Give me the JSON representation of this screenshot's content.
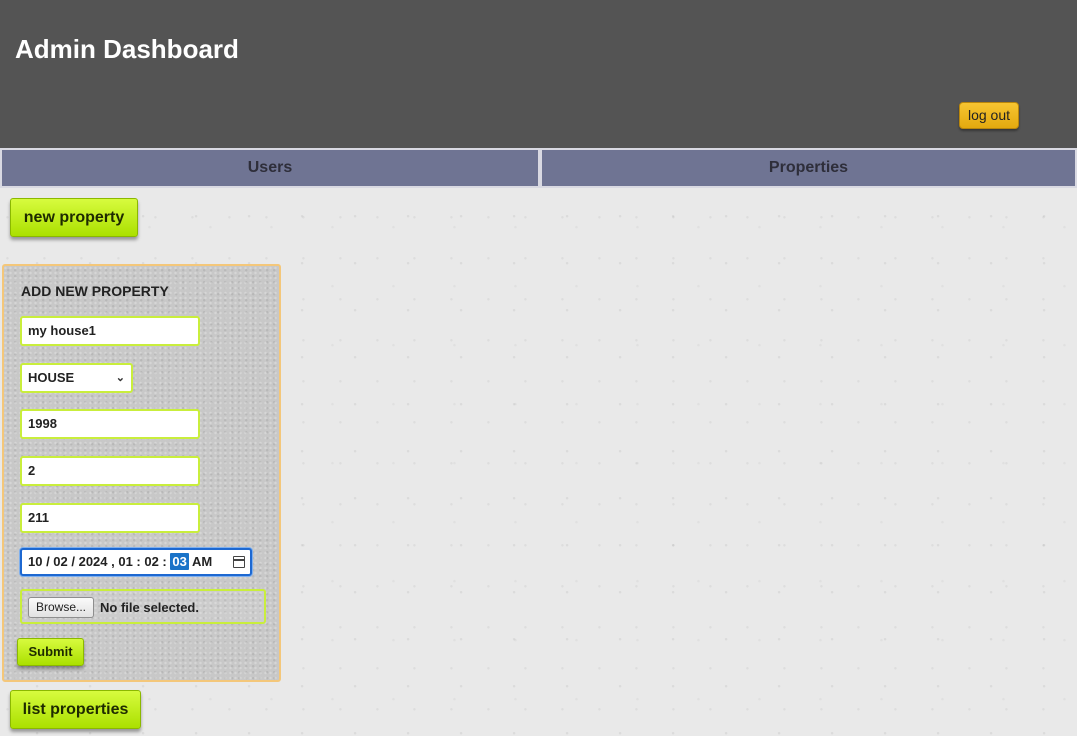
{
  "header": {
    "title": "Admin Dashboard",
    "logout_label": "log out"
  },
  "tabs": [
    {
      "label": "Users"
    },
    {
      "label": "Properties"
    }
  ],
  "actions": {
    "new_property_label": "new property",
    "list_properties_label": "list properties"
  },
  "form": {
    "title": "ADD NEW PROPERTY",
    "name_value": "my house1",
    "type_value": "HOUSE",
    "year_value": "1998",
    "rooms_value": "2",
    "area_value": "211",
    "datetime": {
      "date_part": "10 / 02 / 2024 ,  01 : 02 : ",
      "selected_segment": "03",
      "ampm": "AM"
    },
    "file": {
      "browse_label": "Browse...",
      "status": "No file selected."
    },
    "submit_label": "Submit"
  },
  "colors": {
    "header_bg": "#545454",
    "tab_bg": "#6f7493",
    "accent_green": "#c3f01e",
    "logout_orange": "#f0b41f",
    "panel_border": "#f4c77a",
    "focus_blue": "#1d68d1"
  },
  "icons": {
    "select_chevron": "chevron-down-icon",
    "date_picker": "calendar-icon"
  }
}
